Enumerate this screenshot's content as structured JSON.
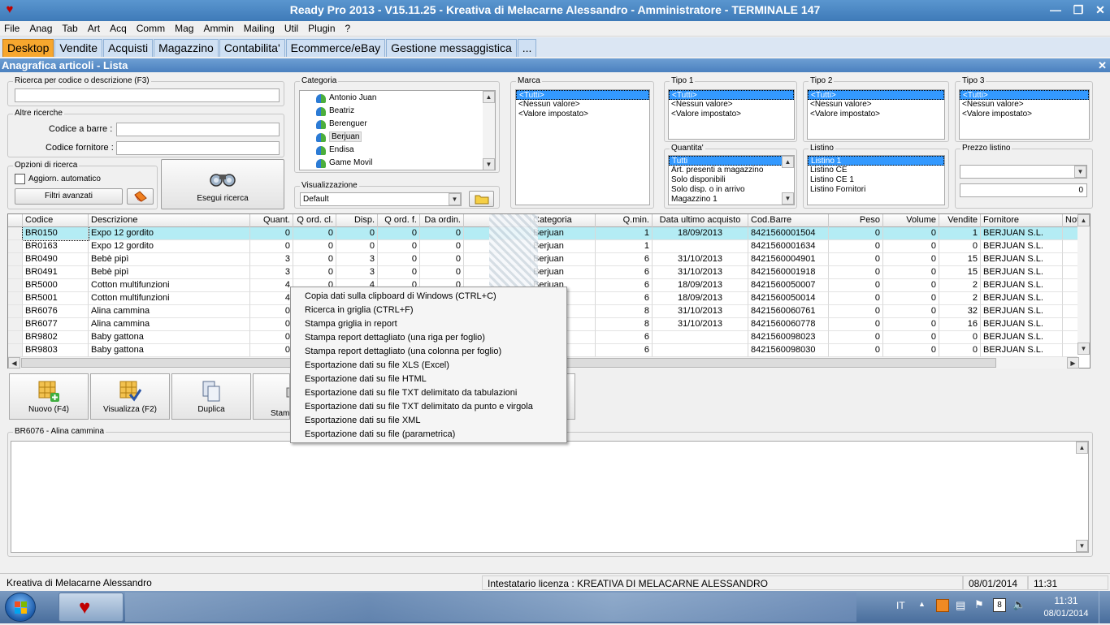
{
  "window": {
    "title": "Ready Pro 2013 - V15.11.25 - Kreativa di Melacarne Alessandro - Amministratore - TERMINALE 147"
  },
  "menu": [
    "File",
    "Anag",
    "Tab",
    "Art",
    "Acq",
    "Comm",
    "Mag",
    "Ammin",
    "Mailing",
    "Util",
    "Plugin",
    "?"
  ],
  "tabs": [
    "Desktop",
    "Vendite",
    "Acquisti",
    "Magazzino",
    "Contabilita'",
    "Ecommerce/eBay",
    "Gestione messaggistica",
    "..."
  ],
  "form": {
    "title": "Anagrafica articoli  - Lista"
  },
  "search": {
    "label": "Ricerca per codice o descrizione (F3)",
    "other_label": "Altre ricerche",
    "barcode_label": "Codice a barre :",
    "supplier_code_label": "Codice fornitore :",
    "options_label": "Opzioni di ricerca",
    "auto_update_label": "Aggiorn. automatico",
    "advanced_filters": "Filtri avanzati",
    "execute": "Esegui ricerca"
  },
  "categoria": {
    "label": "Categoria",
    "items": [
      "Antonio Juan",
      "Beatriz",
      "Berenguer",
      "Berjuan",
      "Endisa",
      "Game Movil"
    ],
    "selected": "Berjuan"
  },
  "visualizzazione": {
    "label": "Visualizzazione",
    "value": "Default"
  },
  "marca": {
    "label": "Marca",
    "items": [
      "<Tutti>",
      "<Nessun valore>",
      "<Valore impostato>"
    ]
  },
  "tipo1": {
    "label": "Tipo 1",
    "items": [
      "<Tutti>",
      "<Nessun valore>",
      "<Valore impostato>"
    ]
  },
  "tipo2": {
    "label": "Tipo 2",
    "items": [
      "<Tutti>",
      "<Nessun valore>",
      "<Valore impostato>"
    ]
  },
  "tipo3": {
    "label": "Tipo 3",
    "items": [
      "<Tutti>",
      "<Nessun valore>",
      "<Valore impostato>"
    ]
  },
  "quantita": {
    "label": "Quantita'",
    "items": [
      "Tutti",
      "Art. presenti a magazzino",
      "Solo disponibili",
      "Solo disp. o in arrivo",
      "Magazzino 1"
    ]
  },
  "listino": {
    "label": "Listino",
    "items": [
      "Listino 1",
      "Listino CE",
      "Listino CE 1",
      "Listino Fornitori"
    ]
  },
  "prezzo_listino": {
    "label": "Prezzo listino",
    "value": "0"
  },
  "grid": {
    "columns": [
      "Codice",
      "Descrizione",
      "Quant.",
      "Q ord. cl.",
      "Disp.",
      "Q ord. f.",
      "Da ordin.",
      "",
      "Categoria",
      "Q.min.",
      "Data ultimo acquisto",
      "Cod.Barre",
      "Peso",
      "Volume",
      "Vendite",
      "Fornitore",
      "Not"
    ],
    "rows": [
      [
        "BR0150",
        "Expo 12 gordito",
        "0",
        "0",
        "0",
        "0",
        "0",
        "",
        "Berjuan",
        "1",
        "18/09/2013",
        "8421560001504",
        "0",
        "0",
        "1",
        "BERJUAN S.L.",
        ""
      ],
      [
        "BR0163",
        "Expo 12 gordito",
        "0",
        "0",
        "0",
        "0",
        "0",
        "",
        "Berjuan",
        "1",
        "",
        "8421560001634",
        "0",
        "0",
        "0",
        "BERJUAN S.L.",
        ""
      ],
      [
        "BR0490",
        "Bebè pipì",
        "3",
        "0",
        "3",
        "0",
        "0",
        "",
        "Berjuan",
        "6",
        "31/10/2013",
        "8421560004901",
        "0",
        "0",
        "15",
        "BERJUAN S.L.",
        ""
      ],
      [
        "BR0491",
        "Bebè pipì",
        "3",
        "0",
        "3",
        "0",
        "0",
        "",
        "Berjuan",
        "6",
        "31/10/2013",
        "8421560001918",
        "0",
        "0",
        "15",
        "BERJUAN S.L.",
        ""
      ],
      [
        "BR5000",
        "Cotton multifunzioni",
        "4",
        "0",
        "4",
        "0",
        "0",
        "",
        "Berjuan",
        "6",
        "18/09/2013",
        "8421560050007",
        "0",
        "0",
        "2",
        "BERJUAN S.L.",
        ""
      ],
      [
        "BR5001",
        "Cotton multifunzioni",
        "4",
        "",
        "",
        "",
        "",
        "",
        "",
        "6",
        "18/09/2013",
        "8421560050014",
        "0",
        "0",
        "2",
        "BERJUAN S.L.",
        ""
      ],
      [
        "BR6076",
        "Alina cammina",
        "0",
        "",
        "",
        "",
        "",
        "",
        "",
        "8",
        "31/10/2013",
        "8421560060761",
        "0",
        "0",
        "32",
        "BERJUAN S.L.",
        ""
      ],
      [
        "BR6077",
        "Alina cammina",
        "0",
        "",
        "",
        "",
        "",
        "",
        "",
        "8",
        "31/10/2013",
        "8421560060778",
        "0",
        "0",
        "16",
        "BERJUAN S.L.",
        ""
      ],
      [
        "BR9802",
        "Baby gattona",
        "0",
        "",
        "",
        "",
        "",
        "",
        "",
        "6",
        "",
        "8421560098023",
        "0",
        "0",
        "0",
        "BERJUAN S.L.",
        ""
      ],
      [
        "BR9803",
        "Baby gattona",
        "0",
        "",
        "",
        "",
        "",
        "",
        "",
        "6",
        "",
        "8421560098030",
        "0",
        "0",
        "0",
        "BERJUAN S.L.",
        ""
      ]
    ]
  },
  "context_menu": [
    "Copia dati sulla clipboard di Windows (CTRL+C)",
    "Ricerca in griglia (CTRL+F)",
    "Stampa griglia in report",
    "Stampa report dettagliato (una riga per foglio)",
    "Stampa report dettagliato (una colonna per foglio)",
    "Esportazione dati su file XLS (Excel)",
    "Esportazione dati su file HTML",
    "Esportazione dati su file TXT delimitato da tabulazioni",
    "Esportazione dati su file TXT delimitato da punto e virgola",
    "Esportazione dati su file XML",
    "Esportazione dati su file (parametrica)"
  ],
  "buttons": {
    "new": "Nuovo (F4)",
    "view": "Visualizza (F2)",
    "duplicate": "Duplica",
    "print": "Stamp"
  },
  "note": {
    "label": "BR6076 - Alina cammina"
  },
  "status": {
    "company": "Kreativa di Melacarne Alessandro",
    "license": "Intestatario licenza : KREATIVA DI MELACARNE ALESSANDRO",
    "date": "08/01/2014",
    "time": "11:31"
  },
  "taskbar": {
    "lang": "IT",
    "time": "11:31",
    "date": "08/01/2014",
    "calendar_day": "8"
  },
  "colors": {
    "accent_tab": "#f7a72e",
    "selected_row": "#b4ecf4",
    "selection": "#3399ff"
  }
}
